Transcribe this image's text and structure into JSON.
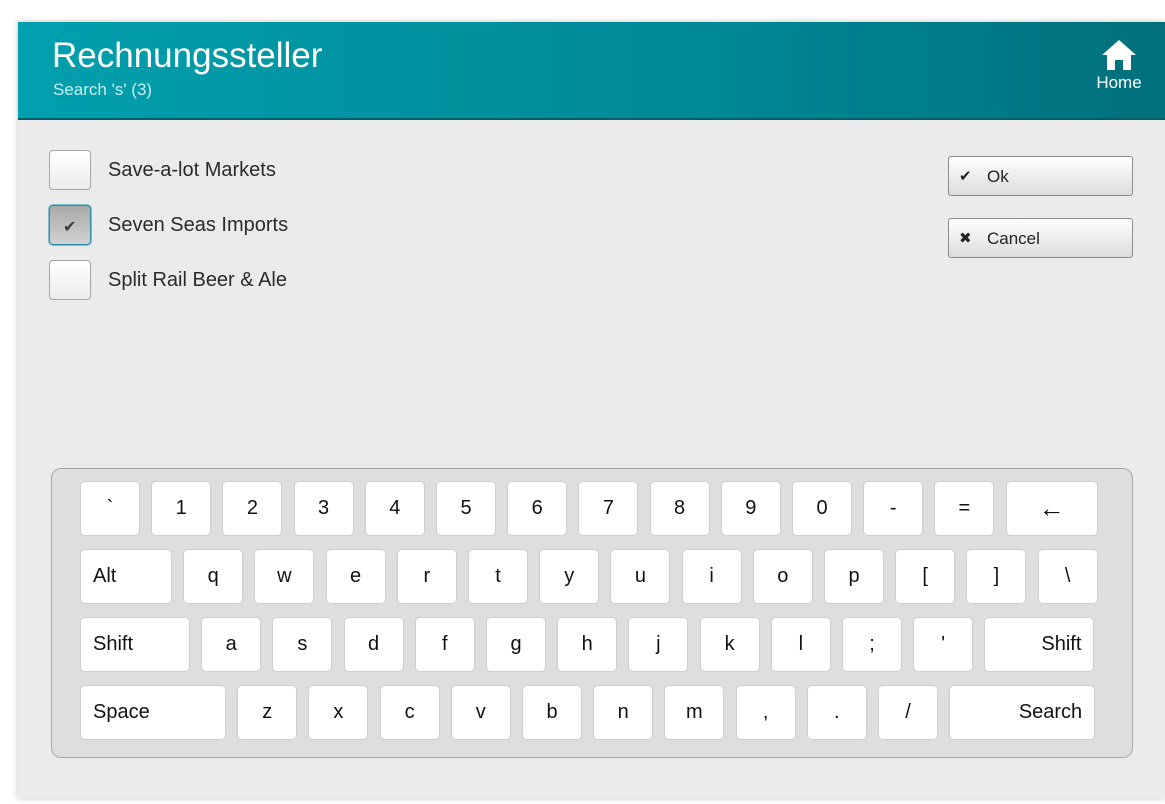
{
  "header": {
    "title": "Rechnungssteller",
    "subtitle": "Search 's' (3)",
    "home_label": "Home"
  },
  "list": {
    "items": [
      {
        "label": "Save-a-lot Markets",
        "checked": false
      },
      {
        "label": "Seven Seas Imports",
        "checked": true
      },
      {
        "label": "Split Rail Beer & Ale",
        "checked": false
      }
    ]
  },
  "buttons": {
    "ok_icon": "✔",
    "ok_label": "Ok",
    "cancel_icon": "✖",
    "cancel_label": "Cancel"
  },
  "keyboard": {
    "rows": [
      [
        "`",
        "1",
        "2",
        "3",
        "4",
        "5",
        "6",
        "7",
        "8",
        "9",
        "0",
        "-",
        "=",
        "←"
      ],
      [
        "Alt",
        "q",
        "w",
        "e",
        "r",
        "t",
        "y",
        "u",
        "i",
        "o",
        "p",
        "[",
        "]",
        "\\"
      ],
      [
        "Shift",
        "a",
        "s",
        "d",
        "f",
        "g",
        "h",
        "j",
        "k",
        "l",
        ";",
        "'",
        "Shift"
      ],
      [
        "Space",
        "z",
        "x",
        "c",
        "v",
        "b",
        "n",
        "m",
        ",",
        ".",
        "/",
        "Search"
      ]
    ]
  },
  "colors": {
    "header_start": "#00a0ae",
    "header_end": "#00707c",
    "background": "#ebebeb"
  }
}
